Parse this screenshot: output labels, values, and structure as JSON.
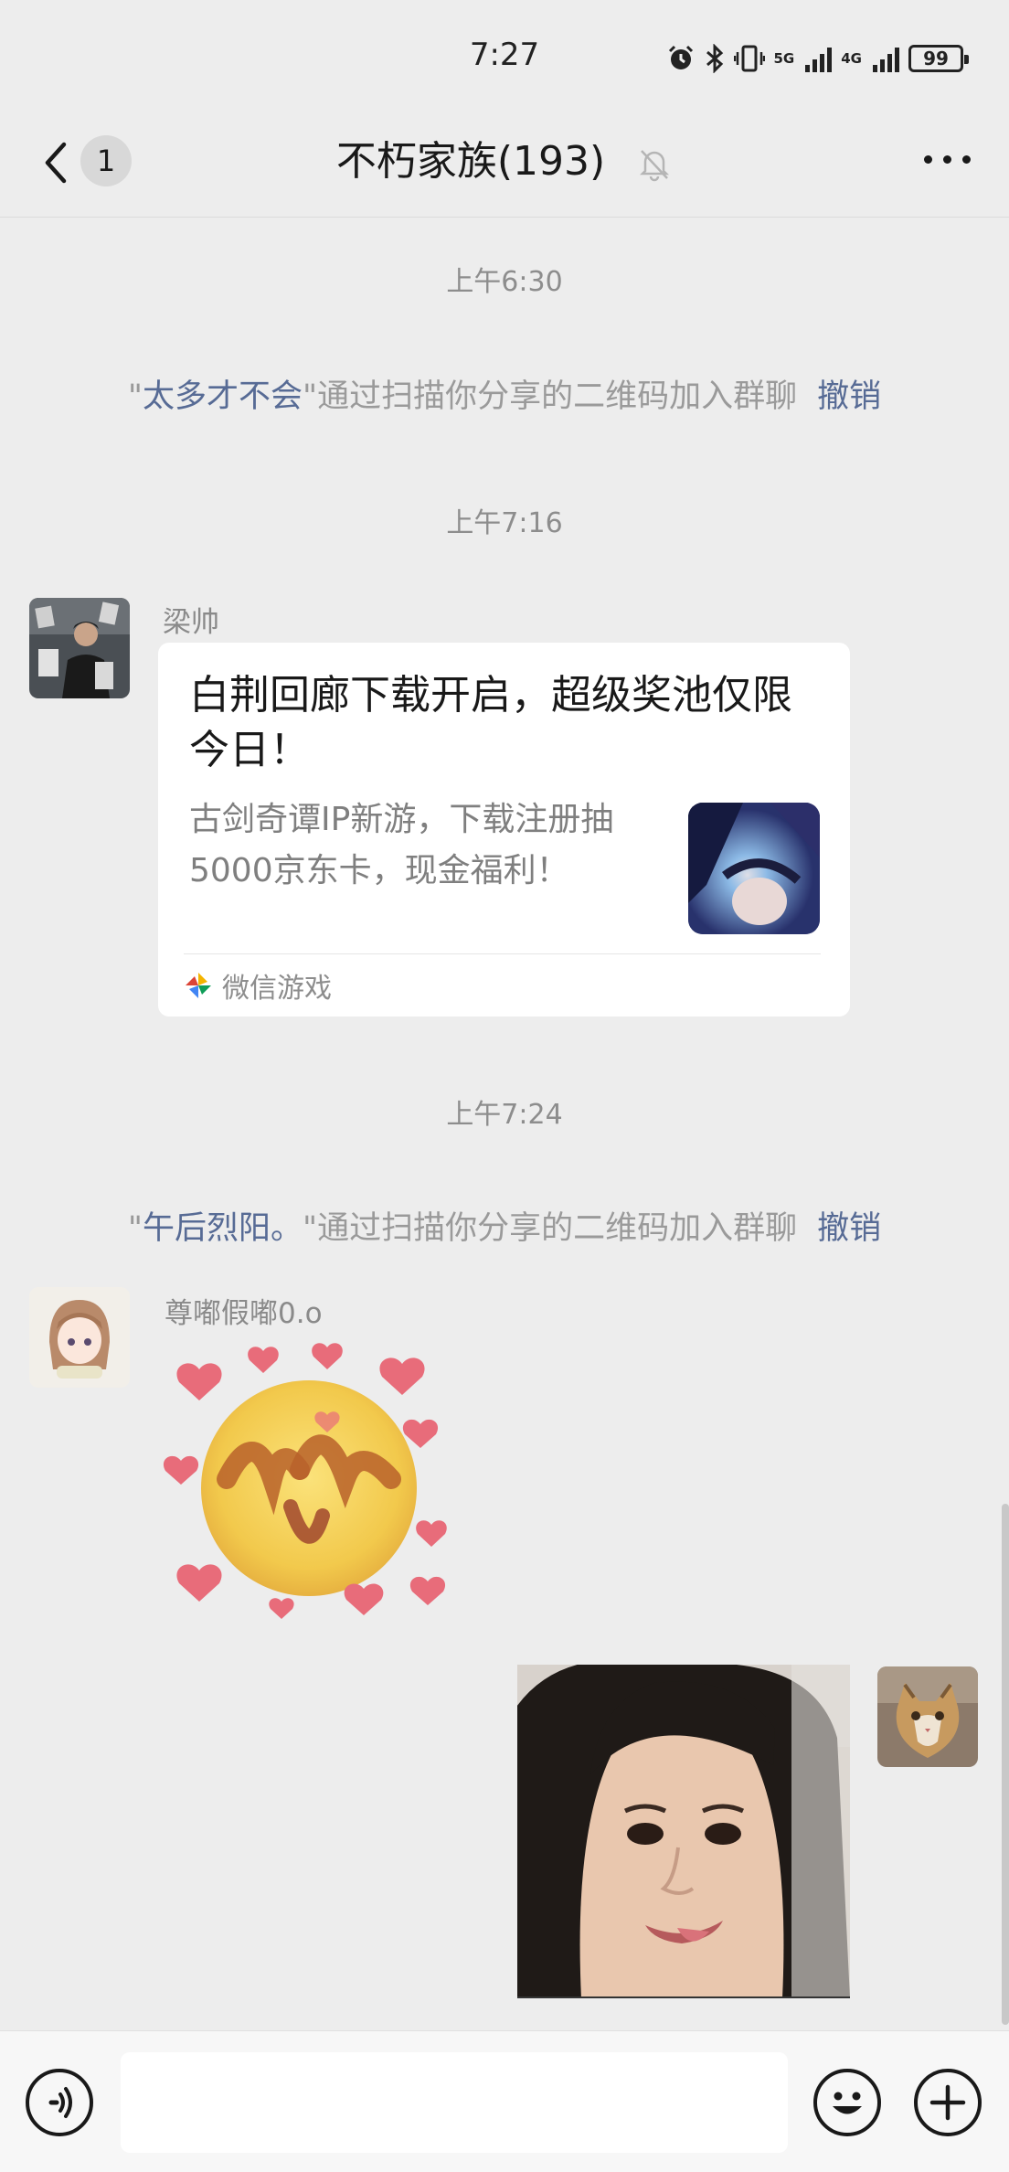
{
  "status_bar": {
    "time": "7:27",
    "battery": "99",
    "network_1": "5G",
    "network_2": "4G",
    "icons": [
      "alarm-icon",
      "bluetooth-icon",
      "vibrate-icon",
      "signal-icon",
      "signal-icon",
      "battery-icon"
    ]
  },
  "header": {
    "back_icon": "chevron-left-icon",
    "unread_count": "1",
    "title": "不朽家族(193)",
    "mute_icon": "bell-off-icon",
    "more_icon": "more-dots-icon"
  },
  "messages": {
    "time_1": "上午6:30",
    "join_1": {
      "quote_open": "\"",
      "nickname": "太多才不会",
      "quote_close": "\"",
      "text": "通过扫描你分享的二维码加入群聊",
      "revoke": "撤销"
    },
    "time_2": "上午7:16",
    "card_message": {
      "sender": "梁帅",
      "title": "白荆回廊下载开启，超级奖池仅限今日！",
      "description": "古剑奇谭IP新游，下载注册抽5000京东卡，现金福利！",
      "source": "微信游戏"
    },
    "time_3": "上午7:24",
    "join_2": {
      "quote_open": "\"",
      "nickname": "午后烈阳。",
      "quote_close": "\"",
      "text": "通过扫描你分享的二维码加入群聊",
      "revoke": "撤销"
    },
    "sticker_message": {
      "sender": "尊嘟假嘟0.o"
    }
  },
  "input_bar": {
    "voice_icon": "voice-icon",
    "emoji_icon": "emoji-icon",
    "add_icon": "plus-icon",
    "input_value": ""
  },
  "colors": {
    "background": "#ededed",
    "link": "#576b95",
    "system_text": "#9a9a9a"
  }
}
